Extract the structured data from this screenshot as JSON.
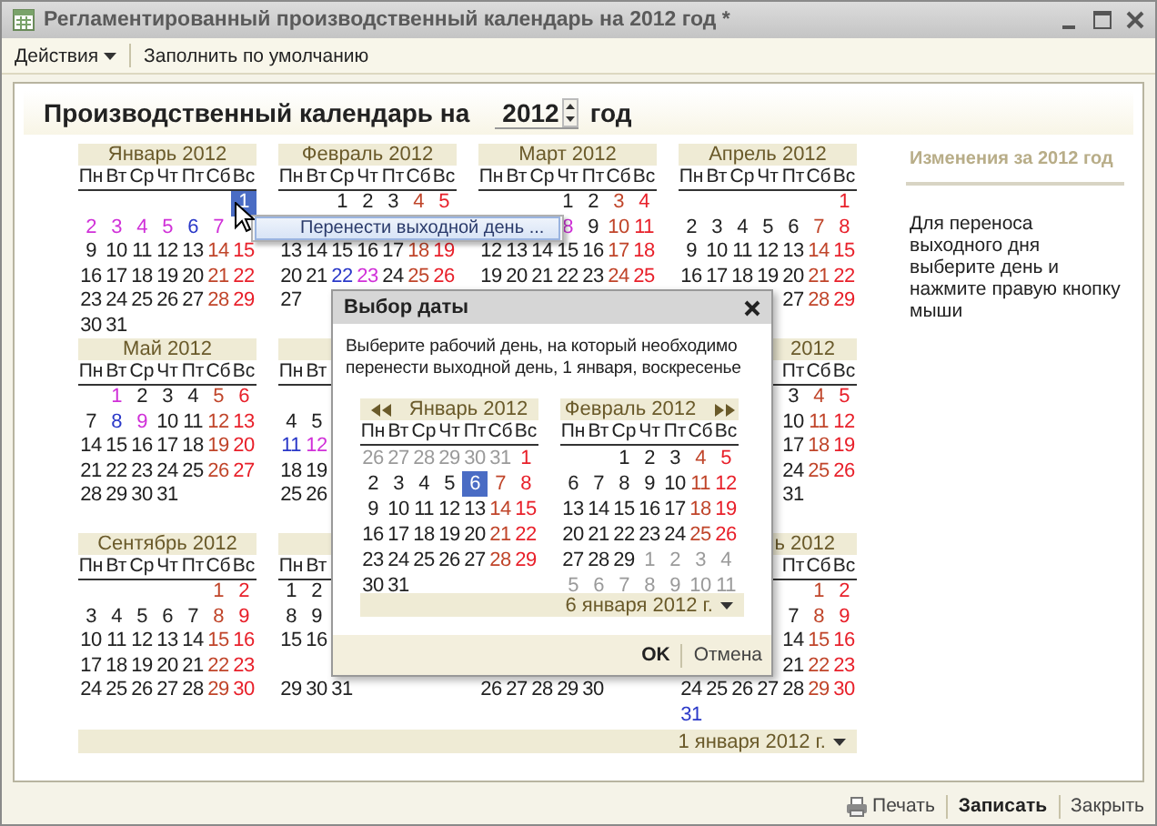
{
  "window": {
    "title": "Регламентированный производственный календарь на 2012 год *"
  },
  "toolbar": [
    {
      "label": "Действия",
      "kind": "menu"
    },
    {
      "label": "Заполнить по умолчанию",
      "kind": "button"
    }
  ],
  "header": {
    "label": "Производственный календарь на",
    "year": "2012",
    "suffix": "год"
  },
  "month_rows": [
    [
      {
        "kind": "month",
        "title": "Январь 2012",
        "weekdays": [
          "Пн",
          "Вт",
          "Ср",
          "Чт",
          "Пт",
          "Сб",
          "Вс"
        ],
        "weeks": [
          [
            {
              "kind": "blank"
            },
            {
              "kind": "blank"
            },
            {
              "kind": "blank"
            },
            {
              "kind": "blank"
            },
            {
              "kind": "blank"
            },
            {
              "kind": "blank"
            },
            {
              "day": "1",
              "kind": "selected"
            }
          ],
          [
            {
              "day": "2",
              "kind": "holiday"
            },
            {
              "day": "3",
              "kind": "holiday"
            },
            {
              "day": "4",
              "kind": "holiday"
            },
            {
              "day": "5",
              "kind": "holiday"
            },
            {
              "day": "6",
              "kind": "preholiday"
            },
            {
              "day": "7",
              "kind": "holiday"
            }
          ],
          [
            {
              "day": "9",
              "kind": "work"
            },
            {
              "day": "10",
              "kind": "work"
            },
            {
              "day": "11",
              "kind": "work"
            },
            {
              "day": "12",
              "kind": "work"
            },
            {
              "day": "13",
              "kind": "work"
            },
            {
              "day": "14",
              "kind": "saturday"
            },
            {
              "day": "15",
              "kind": "sunday"
            }
          ],
          [
            {
              "day": "16",
              "kind": "work"
            },
            {
              "day": "17",
              "kind": "work"
            },
            {
              "day": "18",
              "kind": "work"
            },
            {
              "day": "19",
              "kind": "work"
            },
            {
              "day": "20",
              "kind": "work"
            },
            {
              "day": "21",
              "kind": "saturday"
            },
            {
              "day": "22",
              "kind": "sunday"
            }
          ],
          [
            {
              "day": "23",
              "kind": "work"
            },
            {
              "day": "24",
              "kind": "work"
            },
            {
              "day": "25",
              "kind": "work"
            },
            {
              "day": "26",
              "kind": "work"
            },
            {
              "day": "27",
              "kind": "work"
            },
            {
              "day": "28",
              "kind": "saturday"
            },
            {
              "day": "29",
              "kind": "sunday"
            }
          ],
          [
            {
              "day": "30",
              "kind": "work"
            },
            {
              "day": "31",
              "kind": "work"
            }
          ]
        ]
      },
      {
        "kind": "month",
        "title": "Февраль 2012",
        "weekdays": [
          "Пн",
          "Вт",
          "Ср",
          "Чт",
          "Пт",
          "Сб",
          "Вс"
        ],
        "weeks": [
          [
            {
              "kind": "blank"
            },
            {
              "kind": "blank"
            },
            {
              "day": "1",
              "kind": "work"
            },
            {
              "day": "2",
              "kind": "work"
            },
            {
              "day": "3",
              "kind": "work"
            },
            {
              "day": "4",
              "kind": "saturday"
            },
            {
              "day": "5",
              "kind": "sunday"
            }
          ],
          [
            {
              "kind": "blank"
            }
          ],
          [
            {
              "day": "13",
              "kind": "work"
            },
            {
              "day": "14",
              "kind": "work"
            },
            {
              "day": "15",
              "kind": "work"
            },
            {
              "day": "16",
              "kind": "work"
            },
            {
              "day": "17",
              "kind": "work"
            },
            {
              "day": "18",
              "kind": "saturday"
            },
            {
              "day": "19",
              "kind": "sunday"
            }
          ],
          [
            {
              "day": "20",
              "kind": "work"
            },
            {
              "day": "21",
              "kind": "work"
            },
            {
              "day": "22",
              "kind": "preholiday"
            },
            {
              "day": "23",
              "kind": "holiday"
            },
            {
              "day": "24",
              "kind": "work"
            },
            {
              "day": "25",
              "kind": "saturday"
            },
            {
              "day": "26",
              "kind": "sunday"
            }
          ],
          [
            {
              "day": "27",
              "kind": "work"
            }
          ]
        ]
      },
      {
        "kind": "month",
        "title": "Март 2012",
        "weekdays": [
          "Пн",
          "Вт",
          "Ср",
          "Чт",
          "Пт",
          "Сб",
          "Вс"
        ],
        "weeks": [
          [
            {
              "kind": "blank"
            },
            {
              "kind": "blank"
            },
            {
              "kind": "blank"
            },
            {
              "day": "1",
              "kind": "work"
            },
            {
              "day": "2",
              "kind": "work"
            },
            {
              "day": "3",
              "kind": "saturday"
            },
            {
              "day": "4",
              "kind": "sunday"
            }
          ],
          [
            {
              "kind": "blank"
            },
            {
              "kind": "blank"
            },
            {
              "kind": "blank"
            },
            {
              "day": "8",
              "kind": "holiday"
            },
            {
              "day": "9",
              "kind": "work"
            },
            {
              "day": "10",
              "kind": "saturday"
            },
            {
              "day": "11",
              "kind": "sunday"
            }
          ],
          [
            {
              "day": "12",
              "kind": "work"
            },
            {
              "day": "13",
              "kind": "work"
            },
            {
              "day": "14",
              "kind": "work"
            },
            {
              "day": "15",
              "kind": "work"
            },
            {
              "day": "16",
              "kind": "work"
            },
            {
              "day": "17",
              "kind": "saturday"
            },
            {
              "day": "18",
              "kind": "sunday"
            }
          ],
          [
            {
              "day": "19",
              "kind": "work"
            },
            {
              "day": "20",
              "kind": "work"
            },
            {
              "day": "21",
              "kind": "work"
            },
            {
              "day": "22",
              "kind": "work"
            },
            {
              "day": "23",
              "kind": "work"
            },
            {
              "day": "24",
              "kind": "saturday"
            },
            {
              "day": "25",
              "kind": "sunday"
            }
          ]
        ]
      },
      {
        "kind": "month",
        "title": "Апрель 2012",
        "weekdays": [
          "Пн",
          "Вт",
          "Ср",
          "Чт",
          "Пт",
          "Сб",
          "Вс"
        ],
        "weeks": [
          [
            {
              "kind": "blank"
            },
            {
              "kind": "blank"
            },
            {
              "kind": "blank"
            },
            {
              "kind": "blank"
            },
            {
              "kind": "blank"
            },
            {
              "kind": "blank"
            },
            {
              "day": "1",
              "kind": "sunday"
            }
          ],
          [
            {
              "day": "2",
              "kind": "work"
            },
            {
              "day": "3",
              "kind": "work"
            },
            {
              "day": "4",
              "kind": "work"
            },
            {
              "day": "5",
              "kind": "work"
            },
            {
              "day": "6",
              "kind": "work"
            },
            {
              "day": "7",
              "kind": "saturday"
            },
            {
              "day": "8",
              "kind": "sunday"
            }
          ],
          [
            {
              "day": "9",
              "kind": "work"
            },
            {
              "day": "10",
              "kind": "work"
            },
            {
              "day": "11",
              "kind": "work"
            },
            {
              "day": "12",
              "kind": "work"
            },
            {
              "day": "13",
              "kind": "work"
            },
            {
              "day": "14",
              "kind": "saturday"
            },
            {
              "day": "15",
              "kind": "sunday"
            }
          ],
          [
            {
              "day": "16",
              "kind": "work"
            },
            {
              "day": "17",
              "kind": "work"
            },
            {
              "day": "18",
              "kind": "work"
            },
            {
              "day": "19",
              "kind": "work"
            },
            {
              "day": "20",
              "kind": "work"
            },
            {
              "day": "21",
              "kind": "saturday"
            },
            {
              "day": "22",
              "kind": "sunday"
            }
          ],
          [
            {
              "kind": "blank"
            },
            {
              "kind": "blank"
            },
            {
              "kind": "blank"
            },
            {
              "kind": "blank"
            },
            {
              "day": "27",
              "kind": "work"
            },
            {
              "day": "28",
              "kind": "saturday"
            },
            {
              "day": "29",
              "kind": "sunday"
            }
          ]
        ]
      }
    ],
    [
      {
        "kind": "month",
        "title": "Май 2012",
        "weekdays": [
          "Пн",
          "Вт",
          "Ср",
          "Чт",
          "Пт",
          "Сб",
          "Вс"
        ],
        "weeks": [
          [
            {
              "kind": "blank"
            },
            {
              "day": "1",
              "kind": "holiday"
            },
            {
              "day": "2",
              "kind": "work"
            },
            {
              "day": "3",
              "kind": "work"
            },
            {
              "day": "4",
              "kind": "work"
            },
            {
              "day": "5",
              "kind": "saturday"
            },
            {
              "day": "6",
              "kind": "sunday"
            }
          ],
          [
            {
              "day": "7",
              "kind": "work"
            },
            {
              "day": "8",
              "kind": "preholiday"
            },
            {
              "day": "9",
              "kind": "holiday"
            },
            {
              "day": "10",
              "kind": "work"
            },
            {
              "day": "11",
              "kind": "work"
            },
            {
              "day": "12",
              "kind": "saturday"
            },
            {
              "day": "13",
              "kind": "sunday"
            }
          ],
          [
            {
              "day": "14",
              "kind": "work"
            },
            {
              "day": "15",
              "kind": "work"
            },
            {
              "day": "16",
              "kind": "work"
            },
            {
              "day": "17",
              "kind": "work"
            },
            {
              "day": "18",
              "kind": "work"
            },
            {
              "day": "19",
              "kind": "saturday"
            },
            {
              "day": "20",
              "kind": "sunday"
            }
          ],
          [
            {
              "day": "21",
              "kind": "work"
            },
            {
              "day": "22",
              "kind": "work"
            },
            {
              "day": "23",
              "kind": "work"
            },
            {
              "day": "24",
              "kind": "work"
            },
            {
              "day": "25",
              "kind": "work"
            },
            {
              "day": "26",
              "kind": "saturday"
            },
            {
              "day": "27",
              "kind": "sunday"
            }
          ],
          [
            {
              "day": "28",
              "kind": "work"
            },
            {
              "day": "29",
              "kind": "work"
            },
            {
              "day": "30",
              "kind": "work"
            },
            {
              "day": "31",
              "kind": "work"
            }
          ]
        ]
      },
      {
        "kind": "month",
        "weekdays": [
          "Пн",
          "Вт"
        ],
        "weeks": [
          [
            {
              "kind": "blank"
            }
          ],
          [
            {
              "day": "4",
              "kind": "work"
            },
            {
              "day": "5",
              "kind": "work"
            }
          ],
          [
            {
              "day": "11",
              "kind": "preholiday"
            },
            {
              "day": "12",
              "kind": "holiday"
            }
          ],
          [
            {
              "day": "18",
              "kind": "work"
            },
            {
              "day": "19",
              "kind": "work"
            }
          ],
          [
            {
              "day": "25",
              "kind": "work"
            },
            {
              "day": "26",
              "kind": "work"
            }
          ]
        ]
      },
      {
        "kind": "covered"
      },
      {
        "kind": "month",
        "title": "2012",
        "weekdays": [
          {
            "kind": "blank"
          },
          {
            "kind": "blank"
          },
          {
            "kind": "blank"
          },
          {
            "kind": "blank"
          },
          "Пт",
          "Сб",
          "Вс"
        ],
        "weeks": [
          [
            {
              "kind": "blank"
            },
            {
              "kind": "blank"
            },
            {
              "kind": "blank"
            },
            {
              "kind": "blank"
            },
            {
              "day": "3",
              "kind": "work"
            },
            {
              "day": "4",
              "kind": "saturday"
            },
            {
              "day": "5",
              "kind": "sunday"
            }
          ],
          [
            {
              "kind": "blank"
            },
            {
              "kind": "blank"
            },
            {
              "kind": "blank"
            },
            {
              "kind": "blank"
            },
            {
              "day": "10",
              "kind": "work"
            },
            {
              "day": "11",
              "kind": "saturday"
            },
            {
              "day": "12",
              "kind": "sunday"
            }
          ],
          [
            {
              "kind": "blank"
            },
            {
              "kind": "blank"
            },
            {
              "kind": "blank"
            },
            {
              "kind": "blank"
            },
            {
              "day": "17",
              "kind": "work"
            },
            {
              "day": "18",
              "kind": "saturday"
            },
            {
              "day": "19",
              "kind": "sunday"
            }
          ],
          [
            {
              "kind": "blank"
            },
            {
              "kind": "blank"
            },
            {
              "kind": "blank"
            },
            {
              "kind": "blank"
            },
            {
              "day": "24",
              "kind": "work"
            },
            {
              "day": "25",
              "kind": "saturday"
            },
            {
              "day": "26",
              "kind": "sunday"
            }
          ],
          [
            {
              "kind": "blank"
            },
            {
              "kind": "blank"
            },
            {
              "kind": "blank"
            },
            {
              "kind": "blank"
            },
            {
              "day": "31",
              "kind": "work"
            }
          ]
        ]
      }
    ],
    [
      {
        "kind": "month",
        "title": "Сентябрь 2012",
        "weekdays": [
          "Пн",
          "Вт",
          "Ср",
          "Чт",
          "Пт",
          "Сб",
          "Вс"
        ],
        "weeks": [
          [
            {
              "kind": "blank"
            },
            {
              "kind": "blank"
            },
            {
              "kind": "blank"
            },
            {
              "kind": "blank"
            },
            {
              "kind": "blank"
            },
            {
              "day": "1",
              "kind": "saturday"
            },
            {
              "day": "2",
              "kind": "sunday"
            }
          ],
          [
            {
              "day": "3",
              "kind": "work"
            },
            {
              "day": "4",
              "kind": "work"
            },
            {
              "day": "5",
              "kind": "work"
            },
            {
              "day": "6",
              "kind": "work"
            },
            {
              "day": "7",
              "kind": "work"
            },
            {
              "day": "8",
              "kind": "saturday"
            },
            {
              "day": "9",
              "kind": "sunday"
            }
          ],
          [
            {
              "day": "10",
              "kind": "work"
            },
            {
              "day": "11",
              "kind": "work"
            },
            {
              "day": "12",
              "kind": "work"
            },
            {
              "day": "13",
              "kind": "work"
            },
            {
              "day": "14",
              "kind": "work"
            },
            {
              "day": "15",
              "kind": "saturday"
            },
            {
              "day": "16",
              "kind": "sunday"
            }
          ],
          [
            {
              "day": "17",
              "kind": "work"
            },
            {
              "day": "18",
              "kind": "work"
            },
            {
              "day": "19",
              "kind": "work"
            },
            {
              "day": "20",
              "kind": "work"
            },
            {
              "day": "21",
              "kind": "work"
            },
            {
              "day": "22",
              "kind": "saturday"
            },
            {
              "day": "23",
              "kind": "sunday"
            }
          ],
          [
            {
              "day": "24",
              "kind": "work"
            },
            {
              "day": "25",
              "kind": "work"
            },
            {
              "day": "26",
              "kind": "work"
            },
            {
              "day": "27",
              "kind": "work"
            },
            {
              "day": "28",
              "kind": "work"
            },
            {
              "day": "29",
              "kind": "saturday"
            },
            {
              "day": "30",
              "kind": "sunday"
            }
          ]
        ]
      },
      {
        "kind": "month",
        "weekdays": [
          "Пн",
          "Вт"
        ],
        "weeks": [
          [
            {
              "day": "1",
              "kind": "work"
            },
            {
              "day": "2",
              "kind": "work"
            }
          ],
          [
            {
              "day": "8",
              "kind": "work"
            },
            {
              "day": "9",
              "kind": "work"
            }
          ],
          [
            {
              "day": "15",
              "kind": "work"
            },
            {
              "day": "16",
              "kind": "work"
            }
          ],
          [
            {
              "kind": "blank"
            }
          ],
          [
            {
              "day": "29",
              "kind": "work"
            },
            {
              "day": "30",
              "kind": "work"
            },
            {
              "day": "31",
              "kind": "work"
            }
          ]
        ]
      },
      {
        "kind": "month",
        "weeks": [
          [
            {
              "kind": "blank"
            }
          ],
          [
            {
              "kind": "blank"
            }
          ],
          [
            {
              "kind": "blank"
            }
          ],
          [
            {
              "kind": "blank"
            }
          ],
          [
            {
              "day": "26",
              "kind": "work"
            },
            {
              "day": "27",
              "kind": "work"
            },
            {
              "day": "28",
              "kind": "work"
            },
            {
              "day": "29",
              "kind": "work"
            },
            {
              "day": "30",
              "kind": "work"
            }
          ]
        ]
      },
      {
        "kind": "month",
        "title": "ь 2012",
        "weekdays": [
          {
            "kind": "blank"
          },
          {
            "kind": "blank"
          },
          {
            "kind": "blank"
          },
          {
            "kind": "blank"
          },
          "Пт",
          "Сб",
          "Вс"
        ],
        "weeks": [
          [
            {
              "kind": "blank"
            },
            {
              "kind": "blank"
            },
            {
              "kind": "blank"
            },
            {
              "kind": "blank"
            },
            {
              "kind": "blank"
            },
            {
              "day": "1",
              "kind": "saturday"
            },
            {
              "day": "2",
              "kind": "sunday"
            }
          ],
          [
            {
              "kind": "blank"
            },
            {
              "kind": "blank"
            },
            {
              "kind": "blank"
            },
            {
              "kind": "blank"
            },
            {
              "day": "7",
              "kind": "work"
            },
            {
              "day": "8",
              "kind": "saturday"
            },
            {
              "day": "9",
              "kind": "sunday"
            }
          ],
          [
            {
              "kind": "blank"
            },
            {
              "kind": "blank"
            },
            {
              "kind": "blank"
            },
            {
              "kind": "blank"
            },
            {
              "day": "14",
              "kind": "work"
            },
            {
              "day": "15",
              "kind": "saturday"
            },
            {
              "day": "16",
              "kind": "sunday"
            }
          ],
          [
            {
              "kind": "blank"
            },
            {
              "kind": "blank"
            },
            {
              "kind": "blank"
            },
            {
              "kind": "blank"
            },
            {
              "day": "21",
              "kind": "work"
            },
            {
              "day": "22",
              "kind": "saturday"
            },
            {
              "day": "23",
              "kind": "sunday"
            }
          ],
          [
            {
              "day": "24",
              "kind": "work"
            },
            {
              "day": "25",
              "kind": "work"
            },
            {
              "day": "26",
              "kind": "work"
            },
            {
              "day": "27",
              "kind": "work"
            },
            {
              "day": "28",
              "kind": "work"
            },
            {
              "day": "29",
              "kind": "saturday"
            },
            {
              "day": "30",
              "kind": "sunday"
            }
          ],
          [
            {
              "day": "31",
              "kind": "preholiday"
            }
          ]
        ]
      }
    ]
  ],
  "date": "1 января 2012 г.",
  "side_panel": {
    "title": "Изменения за 2012 год",
    "hint": "Для переноса выходного дня выберите день и нажмите правую кнопку мыши"
  },
  "context_menu": {
    "items": [
      {
        "label": "Перенести выходной день ...",
        "selected": true
      }
    ]
  },
  "dialog": {
    "title": "Выбор даты",
    "message": "Выберите рабочий день, на который необходимо перенести выходной день, 1 января, воскресенье",
    "months": [
      {
        "kind": "prev",
        "title": "Январь 2012",
        "weekdays": [
          "Пн",
          "Вт",
          "Ср",
          "Чт",
          "Пт",
          "Сб",
          "Вс"
        ],
        "weeks": [
          [
            {
              "day": "26",
              "kind": "other"
            },
            {
              "day": "27",
              "kind": "other"
            },
            {
              "day": "28",
              "kind": "other"
            },
            {
              "day": "29",
              "kind": "other"
            },
            {
              "day": "30",
              "kind": "other"
            },
            {
              "day": "31",
              "kind": "other"
            },
            {
              "day": "1",
              "kind": "sunday"
            }
          ],
          [
            {
              "day": "2",
              "kind": "work"
            },
            {
              "day": "3",
              "kind": "work"
            },
            {
              "day": "4",
              "kind": "work"
            },
            {
              "day": "5",
              "kind": "work"
            },
            {
              "day": "6",
              "kind": "selected"
            },
            {
              "day": "7",
              "kind": "saturday"
            },
            {
              "day": "8",
              "kind": "sunday"
            }
          ],
          [
            {
              "day": "9",
              "kind": "work"
            },
            {
              "day": "10",
              "kind": "work"
            },
            {
              "day": "11",
              "kind": "work"
            },
            {
              "day": "12",
              "kind": "work"
            },
            {
              "day": "13",
              "kind": "work"
            },
            {
              "day": "14",
              "kind": "saturday"
            },
            {
              "day": "15",
              "kind": "sunday"
            }
          ],
          [
            {
              "day": "16",
              "kind": "work"
            },
            {
              "day": "17",
              "kind": "work"
            },
            {
              "day": "18",
              "kind": "work"
            },
            {
              "day": "19",
              "kind": "work"
            },
            {
              "day": "20",
              "kind": "work"
            },
            {
              "day": "21",
              "kind": "saturday"
            },
            {
              "day": "22",
              "kind": "sunday"
            }
          ],
          [
            {
              "day": "23",
              "kind": "work"
            },
            {
              "day": "24",
              "kind": "work"
            },
            {
              "day": "25",
              "kind": "work"
            },
            {
              "day": "26",
              "kind": "work"
            },
            {
              "day": "27",
              "kind": "work"
            },
            {
              "day": "28",
              "kind": "saturday"
            },
            {
              "day": "29",
              "kind": "sunday"
            }
          ],
          [
            {
              "day": "30",
              "kind": "work"
            },
            {
              "day": "31",
              "kind": "work"
            }
          ]
        ]
      },
      {
        "kind": "next",
        "title": "Февраль 2012",
        "weekdays": [
          "Пн",
          "Вт",
          "Ср",
          "Чт",
          "Пт",
          "Сб",
          "Вс"
        ],
        "weeks": [
          [
            {
              "kind": "blank"
            },
            {
              "kind": "blank"
            },
            {
              "day": "1",
              "kind": "work"
            },
            {
              "day": "2",
              "kind": "work"
            },
            {
              "day": "3",
              "kind": "work"
            },
            {
              "day": "4",
              "kind": "saturday"
            },
            {
              "day": "5",
              "kind": "sunday"
            }
          ],
          [
            {
              "day": "6",
              "kind": "work"
            },
            {
              "day": "7",
              "kind": "work"
            },
            {
              "day": "8",
              "kind": "work"
            },
            {
              "day": "9",
              "kind": "work"
            },
            {
              "day": "10",
              "kind": "work"
            },
            {
              "day": "11",
              "kind": "saturday"
            },
            {
              "day": "12",
              "kind": "sunday"
            }
          ],
          [
            {
              "day": "13",
              "kind": "work"
            },
            {
              "day": "14",
              "kind": "work"
            },
            {
              "day": "15",
              "kind": "work"
            },
            {
              "day": "16",
              "kind": "work"
            },
            {
              "day": "17",
              "kind": "work"
            },
            {
              "day": "18",
              "kind": "saturday"
            },
            {
              "day": "19",
              "kind": "sunday"
            }
          ],
          [
            {
              "day": "20",
              "kind": "work"
            },
            {
              "day": "21",
              "kind": "work"
            },
            {
              "day": "22",
              "kind": "work"
            },
            {
              "day": "23",
              "kind": "work"
            },
            {
              "day": "24",
              "kind": "work"
            },
            {
              "day": "25",
              "kind": "saturday"
            },
            {
              "day": "26",
              "kind": "sunday"
            }
          ],
          [
            {
              "day": "27",
              "kind": "work"
            },
            {
              "day": "28",
              "kind": "work"
            },
            {
              "day": "29",
              "kind": "work"
            },
            {
              "day": "1",
              "kind": "other"
            },
            {
              "day": "2",
              "kind": "other"
            },
            {
              "day": "3",
              "kind": "other"
            },
            {
              "day": "4",
              "kind": "other"
            }
          ],
          [
            {
              "day": "5",
              "kind": "other"
            },
            {
              "day": "6",
              "kind": "other"
            },
            {
              "day": "7",
              "kind": "other"
            },
            {
              "day": "8",
              "kind": "other"
            },
            {
              "day": "9",
              "kind": "other"
            },
            {
              "day": "10",
              "kind": "other"
            },
            {
              "day": "11",
              "kind": "other"
            }
          ]
        ]
      }
    ],
    "date": "6 января 2012 г.",
    "buttons": [
      {
        "label": "OK",
        "kind": "default"
      },
      {
        "label": "Отмена",
        "kind": "normal"
      }
    ]
  },
  "footer_buttons": [
    {
      "label": "Печать",
      "kind": "print"
    },
    {
      "label": "Записать",
      "kind": "default"
    },
    {
      "label": "Закрыть",
      "kind": "normal"
    }
  ]
}
